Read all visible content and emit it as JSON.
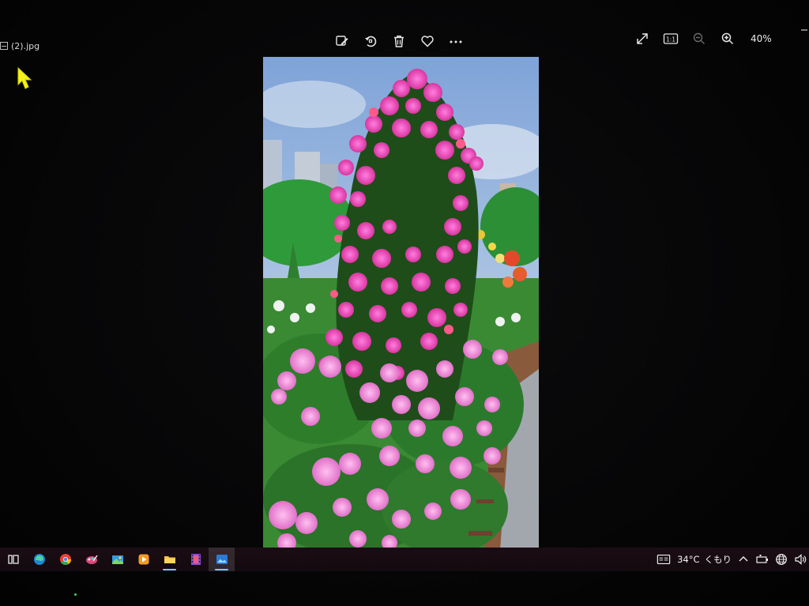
{
  "window": {
    "file_name": "(2).jpg",
    "zoom_level": "40%",
    "icons": {
      "edit": "edit-image-icon",
      "rotate": "rotate-icon",
      "delete": "trash-icon",
      "favorite": "heart-icon",
      "more": "more-icon",
      "fullscreen": "expand-icon",
      "actual_size": "actual-size-icon",
      "zoom_out": "zoom-out-icon",
      "zoom_in": "zoom-in-icon"
    },
    "actual_size_label": "1:1"
  },
  "taskbar": {
    "apps": [
      {
        "name": "task-view",
        "icon": "task-view-icon",
        "running": false,
        "active": false
      },
      {
        "name": "edge",
        "icon": "edge-icon",
        "running": false,
        "active": false
      },
      {
        "name": "chrome",
        "icon": "chrome-icon",
        "running": false,
        "active": false
      },
      {
        "name": "paint",
        "icon": "paint-icon",
        "running": false,
        "active": false
      },
      {
        "name": "photo-gallery",
        "icon": "gallery-icon",
        "running": false,
        "active": false
      },
      {
        "name": "media-player",
        "icon": "media-player-icon",
        "running": false,
        "active": false
      },
      {
        "name": "file-explorer",
        "icon": "folder-icon",
        "running": true,
        "active": false
      },
      {
        "name": "video-editor",
        "icon": "film-icon",
        "running": false,
        "active": false
      },
      {
        "name": "photos",
        "icon": "photos-icon",
        "running": true,
        "active": true
      }
    ],
    "tray": {
      "temperature": "34°C",
      "weather": "くもり",
      "icons": [
        "weather-icon",
        "chevron-up-icon",
        "battery-icon",
        "network-icon",
        "speaker-icon"
      ]
    }
  },
  "colors": {
    "background": "#050505",
    "taskbar": "#1b0c14",
    "running_indicator": "#7fc6ff",
    "cursor": "#f4f21a"
  }
}
